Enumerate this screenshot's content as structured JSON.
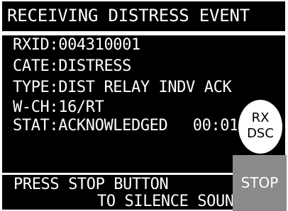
{
  "header": {
    "title": "RECEIVING DISTRESS EVENT"
  },
  "details": {
    "rxid": "RXID:004310001",
    "category": "CATE:DISTRESS",
    "type": "TYPE:DIST RELAY INDV ACK",
    "working_channel": "W-CH:16/RT",
    "status": "STAT:ACKNOWLEDGED",
    "time": "00:01"
  },
  "rx_indicator": {
    "line1": "RX",
    "line2": "DSC"
  },
  "footer": {
    "message_line1": "PRESS STOP BUTTON",
    "message_line2": "TO SILENCE SOUND."
  },
  "actions": {
    "stop_label": "STOP"
  },
  "colors": {
    "screen_background": "#000000",
    "text": "#ffffff",
    "stop_button": "#8a8a8a",
    "indicator_fill": "#ffffff"
  }
}
